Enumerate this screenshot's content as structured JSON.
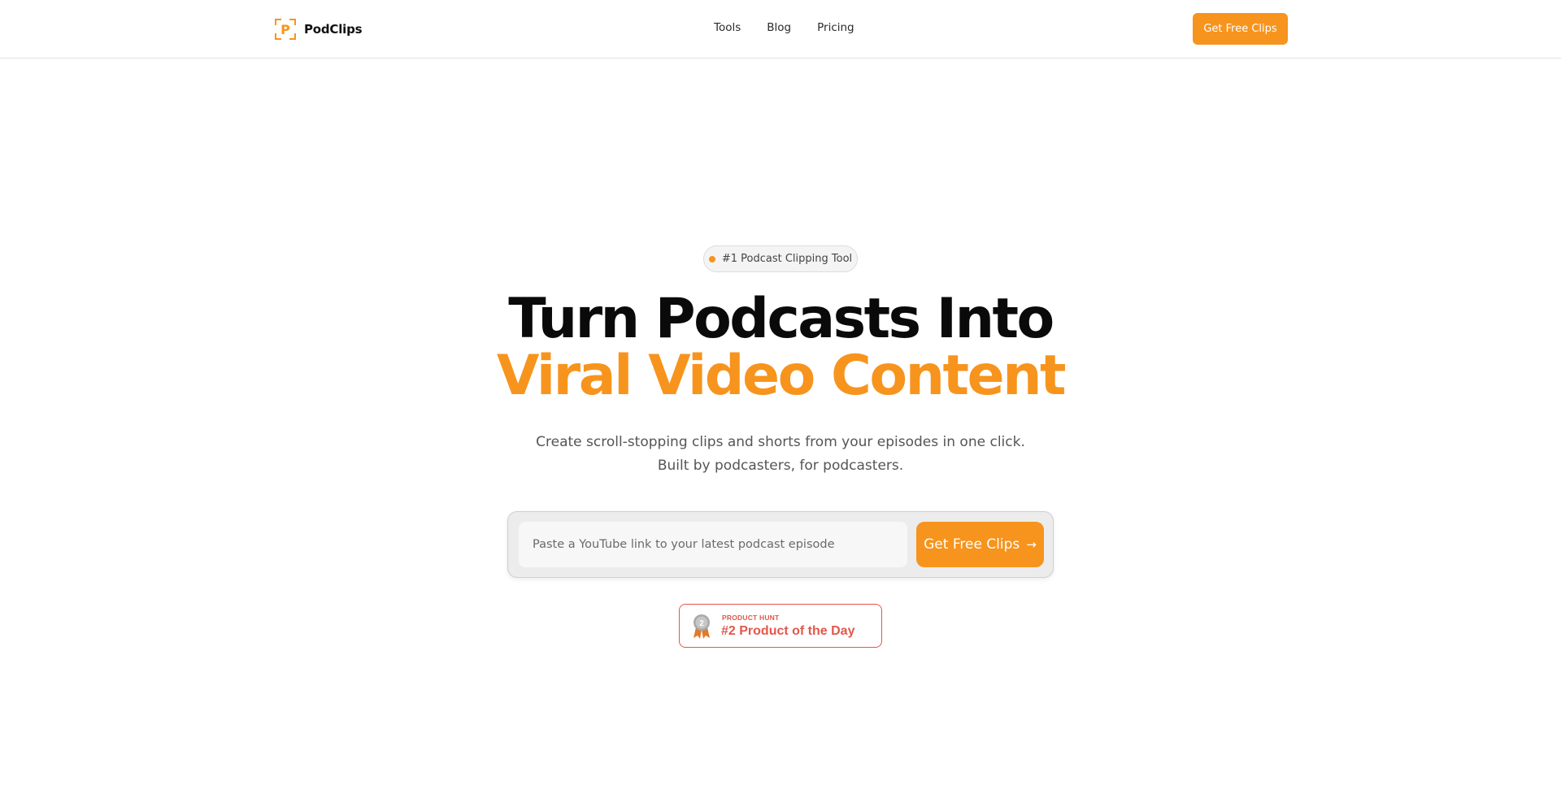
{
  "header": {
    "brand": "PodClips",
    "logo_letter": "P",
    "nav": [
      {
        "label": "Tools"
      },
      {
        "label": "Blog"
      },
      {
        "label": "Pricing"
      }
    ],
    "cta_label": "Get Free Clips"
  },
  "hero": {
    "badge_text": "#1 Podcast Clipping Tool",
    "headline_line1": "Turn Podcasts Into",
    "headline_line2": "Viral Video Content",
    "subtext_line1": "Create scroll-stopping clips and shorts from your episodes in one click.",
    "subtext_line2": "Built by podcasters, for podcasters."
  },
  "search": {
    "placeholder": "Paste a YouTube link to your latest podcast episode",
    "value": "",
    "button_label": "Get Free Clips",
    "button_icon": "arrow-right-icon"
  },
  "product_hunt": {
    "small_label": "PRODUCT HUNT",
    "big_label": "#2 Product of the Day",
    "medal_number": "2"
  },
  "colors": {
    "accent": "#f7941d",
    "product_hunt": "#e2574c",
    "text_dark": "#0a0a0a",
    "text_muted": "#555555"
  }
}
